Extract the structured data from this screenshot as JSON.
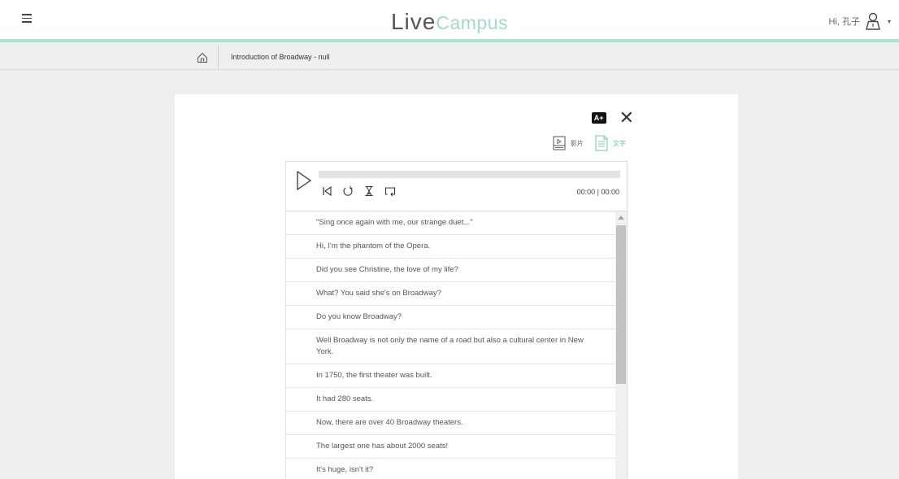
{
  "header": {
    "logo_live": "Live",
    "logo_campus": "Campus",
    "greeting": "Hi, 孔子",
    "icons": {
      "menu": "hamburger-menu-icon",
      "user": "user-icon",
      "caret": "caret-down-icon"
    }
  },
  "breadcrumb": {
    "home_icon": "home-icon",
    "title": "Introduction of Broadway - null"
  },
  "toolbar": {
    "font_size_label": "A+",
    "close_label": "✕"
  },
  "mode_tabs": {
    "video_label": "影片",
    "text_label": "文字",
    "active": "text",
    "accent_color": "#6cc7a7"
  },
  "player": {
    "time_display": "00:00 | 00:00",
    "progress": 0,
    "icons": [
      "play-icon",
      "skip-back-icon",
      "replay-icon",
      "hourglass-icon",
      "loop-icon"
    ]
  },
  "transcript": {
    "lines": [
      "\"Sing once again with me, our strange duet...\"",
      "Hi, I'm the phantom of the Opera.",
      "Did you see Christine, the love of my life?",
      "What? You said she's on Broadway?",
      "Do you know Broadway?",
      "Well Broadway is not only the name of a road but also a cultural center in New York.",
      "In 1750, the first theater was built.",
      "It had 280 seats.",
      "Now, there are over 40 Broadway theaters.",
      "The largest one has about 2000 seats!",
      "It's huge, isn't it?"
    ]
  },
  "colors": {
    "accent": "#9fdccb",
    "header_border": "#a9e3d6",
    "background": "#eeeeee"
  }
}
